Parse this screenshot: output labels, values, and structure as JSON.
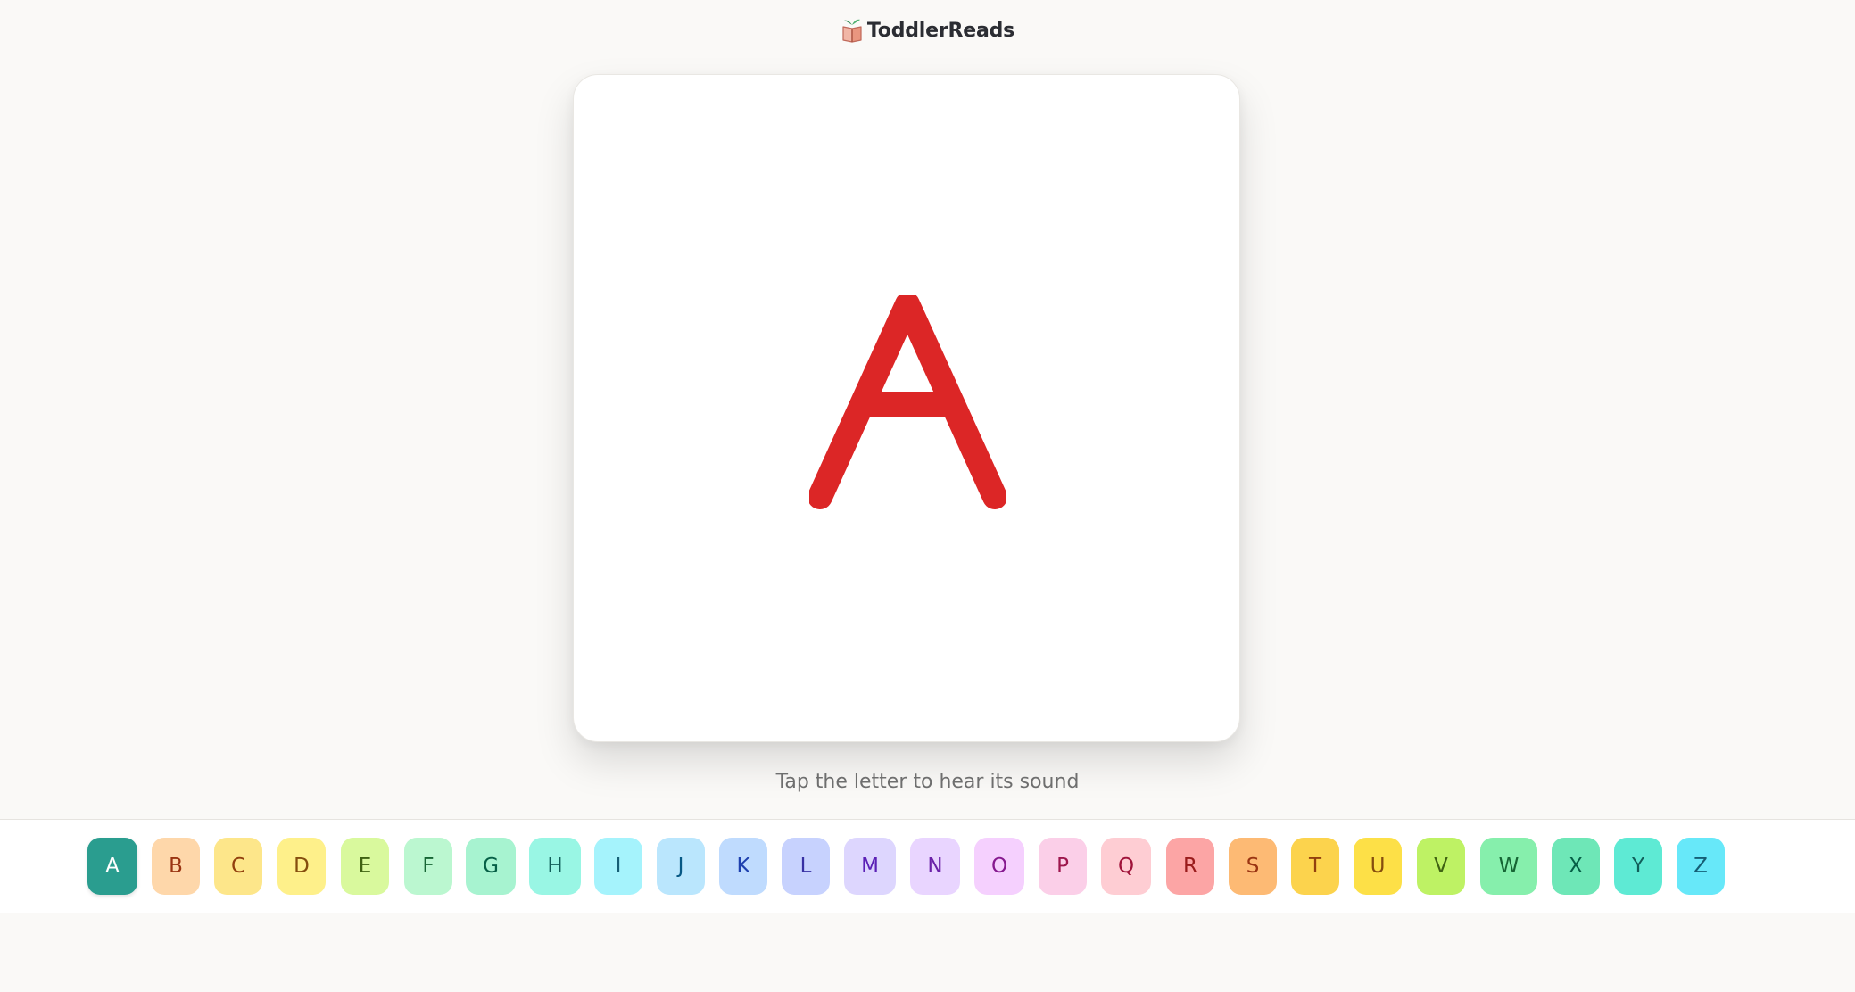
{
  "app": {
    "name": "ToddlerReads"
  },
  "card": {
    "letter": "A",
    "letter_color": "#dc2626"
  },
  "hint": "Tap the letter to hear its sound",
  "alphabet": {
    "selected": "A",
    "letters": [
      {
        "label": "A",
        "bg": "#2a9d8f",
        "fg": "#ffffff"
      },
      {
        "label": "B",
        "bg": "#fed7aa",
        "fg": "#9a3412"
      },
      {
        "label": "C",
        "bg": "#fde68a",
        "fg": "#92400e"
      },
      {
        "label": "D",
        "bg": "#fef08a",
        "fg": "#854d0e"
      },
      {
        "label": "E",
        "bg": "#d9f99d",
        "fg": "#3f6212"
      },
      {
        "label": "F",
        "bg": "#bbf7d0",
        "fg": "#166534"
      },
      {
        "label": "G",
        "bg": "#a7f3d0",
        "fg": "#065f46"
      },
      {
        "label": "H",
        "bg": "#99f6e4",
        "fg": "#115e59"
      },
      {
        "label": "I",
        "bg": "#a5f3fc",
        "fg": "#155e75"
      },
      {
        "label": "J",
        "bg": "#bae6fd",
        "fg": "#075985"
      },
      {
        "label": "K",
        "bg": "#bfdbfe",
        "fg": "#1e40af"
      },
      {
        "label": "L",
        "bg": "#c7d2fe",
        "fg": "#3730a3"
      },
      {
        "label": "M",
        "bg": "#ddd6fe",
        "fg": "#5b21b6"
      },
      {
        "label": "N",
        "bg": "#e9d5ff",
        "fg": "#6b21a8"
      },
      {
        "label": "O",
        "bg": "#f5d0fe",
        "fg": "#86198f"
      },
      {
        "label": "P",
        "bg": "#fbcfe8",
        "fg": "#9d174d"
      },
      {
        "label": "Q",
        "bg": "#fecdd3",
        "fg": "#9f1239"
      },
      {
        "label": "R",
        "bg": "#fca5a5",
        "fg": "#991b1b"
      },
      {
        "label": "S",
        "bg": "#fdba74",
        "fg": "#9a3412"
      },
      {
        "label": "T",
        "bg": "#fcd34d",
        "fg": "#92400e"
      },
      {
        "label": "U",
        "bg": "#fde047",
        "fg": "#854d0e"
      },
      {
        "label": "V",
        "bg": "#bef264",
        "fg": "#3f6212"
      },
      {
        "label": "W",
        "bg": "#86efac",
        "fg": "#166534"
      },
      {
        "label": "X",
        "bg": "#6ee7b7",
        "fg": "#065f46"
      },
      {
        "label": "Y",
        "bg": "#5eead4",
        "fg": "#115e59"
      },
      {
        "label": "Z",
        "bg": "#67e8f9",
        "fg": "#155e75"
      }
    ]
  }
}
